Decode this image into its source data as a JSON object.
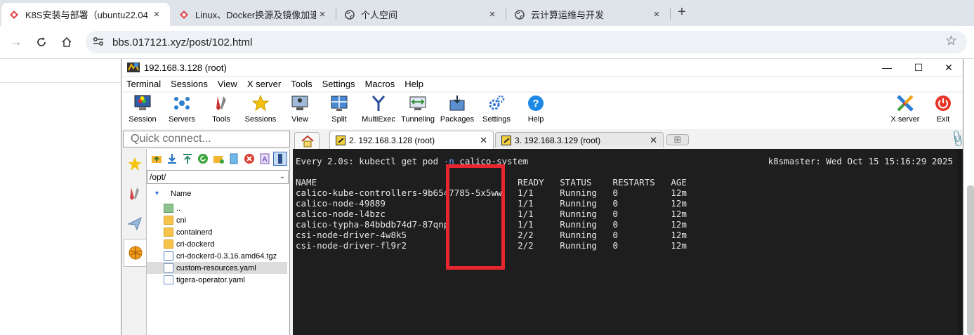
{
  "browser": {
    "tabs": [
      {
        "title": "K8S安装与部署（ubuntu22.04",
        "close": "×"
      },
      {
        "title": "Linux、Docker换源及镜像加速",
        "close": "×"
      },
      {
        "title": "个人空间",
        "close": "×"
      },
      {
        "title": "云计算运维与开发",
        "close": "×"
      }
    ],
    "new_tab": "+",
    "url": "bbs.017121.xyz/post/102.html"
  },
  "moba": {
    "title": "192.168.3.128 (root)",
    "window_controls": {
      "minimize": "—",
      "maximize": "☐",
      "close": "✕"
    },
    "menu": [
      "Terminal",
      "Sessions",
      "View",
      "X server",
      "Tools",
      "Settings",
      "Macros",
      "Help"
    ],
    "toolbar": [
      "Session",
      "Servers",
      "Tools",
      "Sessions",
      "View",
      "Split",
      "MultiExec",
      "Tunneling",
      "Packages",
      "Settings",
      "Help"
    ],
    "toolbar_right": [
      "X server",
      "Exit"
    ],
    "quick_connect_placeholder": "Quick connect...",
    "session_tabs": [
      {
        "label": "2. 192.168.3.128 (root)",
        "close": "✕",
        "active": true
      },
      {
        "label": "3. 192.168.3.129 (root)",
        "close": "✕",
        "active": false
      }
    ],
    "add_tab": "⊞",
    "sftp": {
      "path": "/opt/",
      "column": "Name",
      "files": [
        {
          "name": "..",
          "type": "up"
        },
        {
          "name": "cni",
          "type": "folder"
        },
        {
          "name": "containerd",
          "type": "folder"
        },
        {
          "name": "cri-dockerd",
          "type": "folder"
        },
        {
          "name": "cri-dockerd-0.3.16.amd64.tgz",
          "type": "tgz"
        },
        {
          "name": "custom-resources.yaml",
          "type": "yaml",
          "selected": true
        },
        {
          "name": "tigera-operator.yaml",
          "type": "yaml"
        }
      ]
    },
    "terminal": {
      "watch_prefix": "Every 2.0s: kubectl get pod ",
      "watch_opt": "-n",
      "watch_suffix": " calico-system",
      "host_time": "k8smaster: Wed Oct 15 15:16:29 2025",
      "header": "NAME                                      READY   STATUS    RESTARTS   AGE",
      "rows": [
        "calico-kube-controllers-9b6547785-5x5ww   1/1     Running   0          12m",
        "calico-node-49889                         1/1     Running   0          12m",
        "calico-node-l4bzc                         1/1     Running   0          12m",
        "calico-typha-84bbdb74d7-87qnp             1/1     Running   0          12m",
        "csi-node-driver-4w8k5                     2/2     Running   0          12m",
        "csi-node-driver-fl9r2                     2/2     Running   0          12m"
      ]
    }
  },
  "colors": {
    "highlight": "#e8262f",
    "terminal_bg": "#1e1e1e",
    "option_blue": "#6fa3ff"
  }
}
